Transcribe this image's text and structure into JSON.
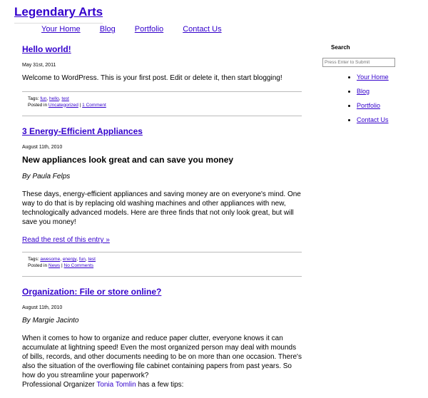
{
  "site": {
    "title": "Legendary Arts"
  },
  "nav": [
    "Your Home",
    "Blog",
    "Portfolio",
    "Contact Us"
  ],
  "sidebar": {
    "search_label": "Search",
    "search_placeholder": "Press Enter to Submit",
    "links": [
      "Your Home",
      "Blog",
      "Portfolio",
      "Contact Us"
    ]
  },
  "posts": [
    {
      "title": "Hello world!",
      "date": "May 31st, 2011",
      "body": [
        "Welcome to WordPress. This is your first post. Edit or delete it, then start blogging!"
      ],
      "tags_label": "Tags:",
      "tags": [
        "fun",
        "hello",
        "test"
      ],
      "posted_in_label": "Posted in",
      "category": "Uncategorized",
      "sep": "|",
      "comments": "1 Comment"
    },
    {
      "title": "3 Energy-Efficient Appliances",
      "date": "August 11th, 2010",
      "subtitle": "New appliances look great and can save you money",
      "byline": "By Paula Felps",
      "body": [
        "These days, energy-efficient appliances and saving money are on everyone's mind. One way to do that is by replacing old washing machines and other appliances with new, technologically advanced models. Here are three finds that not only look great, but will save you money!"
      ],
      "more": "Read the rest of this entry »",
      "tags_label": "Tags:",
      "tags": [
        "awesome",
        "energy",
        "fun",
        "test"
      ],
      "posted_in_label": "Posted in",
      "category": "News",
      "sep": "|",
      "comments": "No Comments"
    },
    {
      "title": "Organization: File or store online?",
      "date": "August 11th, 2010",
      "byline": "By Margie Jacinto",
      "body_main": "When it comes to how to organize and reduce paper clutter, everyone knows it can accumulate at lightning speed! Even the most organized person may deal with mounds of bills, records, and other documents needing to be on more than one occasion. There's also the situation of the overflowing file cabinet containing papers from past years. So how do you streamline your paperwork?",
      "body_prefix": "Professional Organizer ",
      "body_link": "Tonia Tomlin",
      "body_suffix": " has a few tips:"
    }
  ]
}
